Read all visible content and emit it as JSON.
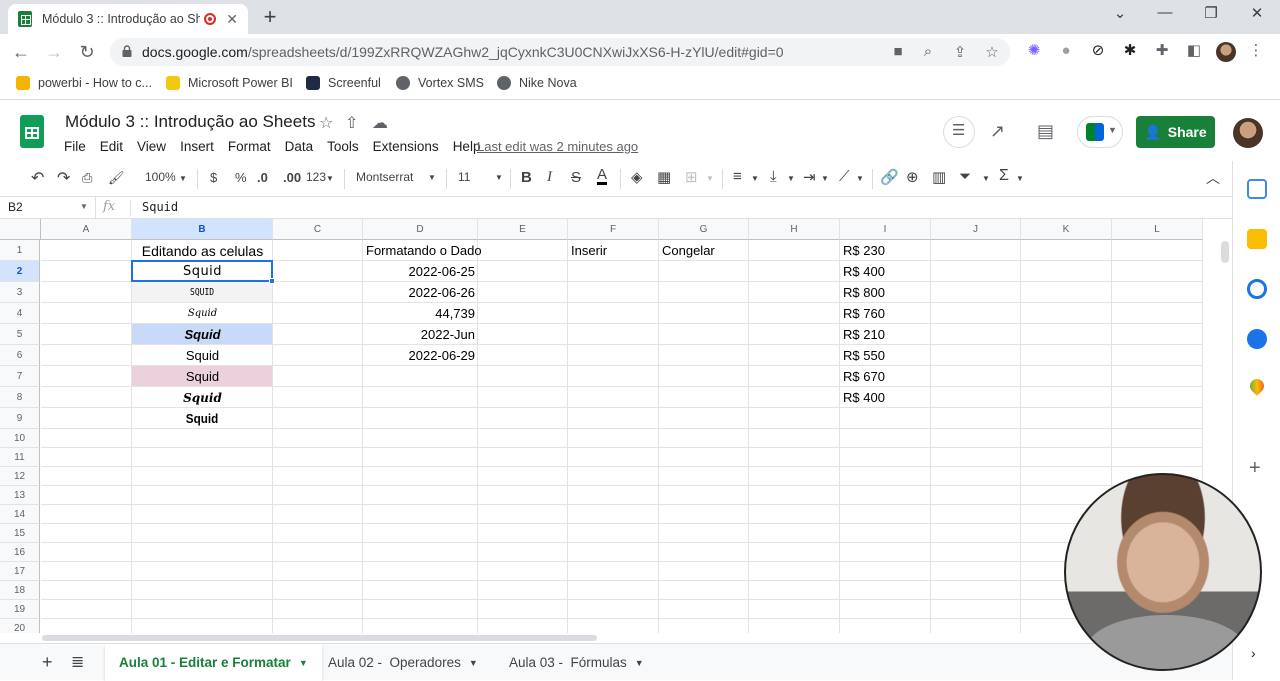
{
  "browser": {
    "tab_title": "Módulo 3 :: Introdução ao Sh",
    "url_host": "docs.google.com",
    "url_path": "/spreadsheets/d/199ZxRRQWZAGhw2_jqCyxnkC3U0CNXwiJxXS6-H-zYlU/edit#gid=0",
    "bookmarks": [
      {
        "label": "powerbi - How to c...",
        "color": "#f4b400"
      },
      {
        "label": "Microsoft Power BI",
        "color": "#f2c811"
      },
      {
        "label": "Screenful",
        "color": "#1f2a44"
      },
      {
        "label": "Vortex SMS",
        "color": "#5f6368"
      },
      {
        "label": "Nike Nova",
        "color": "#5f6368"
      }
    ]
  },
  "sheets": {
    "doc_title": "Módulo 3 :: Introdução ao Sheets",
    "menu": [
      "File",
      "Edit",
      "View",
      "Insert",
      "Format",
      "Data",
      "Tools",
      "Extensions",
      "Help"
    ],
    "last_edit": "Last edit was 2 minutes ago",
    "share_label": "Share",
    "accent": "#188038"
  },
  "toolbar": {
    "zoom": "100%",
    "currency": "$",
    "percent": "%",
    "dec_decrease": ".0",
    "dec_increase": ".00",
    "more_formats": "123",
    "font": "Montserrat",
    "font_size": "11"
  },
  "formula_bar": {
    "name_box": "B2",
    "fx": "fx",
    "content": "Squid"
  },
  "columns": [
    "A",
    "B",
    "C",
    "D",
    "E",
    "F",
    "G",
    "H",
    "I",
    "J",
    "K",
    "L"
  ],
  "rows": [
    "1",
    "2",
    "3",
    "4",
    "5",
    "6",
    "7",
    "8",
    "9",
    "10",
    "11",
    "12",
    "13",
    "14",
    "15",
    "16",
    "17",
    "18",
    "19",
    "20"
  ],
  "cells": {
    "B1": "Editando as celulas",
    "B2": "Squid",
    "B3": "SQUID",
    "B4": "Squid",
    "B5": "Squid",
    "B6": "Squid",
    "B7": "Squid",
    "B8": "Squid",
    "B9": "Squid",
    "D1": "Formatando o Dado",
    "D2": "2022-06-25",
    "D3": "2022-06-26",
    "D4": "44,739",
    "D5": "2022-Jun",
    "D6": "2022-06-29",
    "F1": "Inserir",
    "G1": "Congelar",
    "I1": "R$ 230",
    "I2": "R$ 400",
    "I3": "R$ 800",
    "I4": "R$ 760",
    "I5": "R$ 210",
    "I6": "R$ 550",
    "I7": "R$ 670",
    "I8": "R$ 400"
  },
  "cell_fills": {
    "B3": "#f3f3f3",
    "B5": "#c9daf8",
    "B7": "#ead1dc"
  },
  "sheet_tabs": [
    {
      "label": "Aula 01 - Editar e Formatar",
      "active": true
    },
    {
      "label": "Aula 02 -  Operadores",
      "active": false
    },
    {
      "label": "Aula 03 -  Fórmulas",
      "active": false
    }
  ]
}
